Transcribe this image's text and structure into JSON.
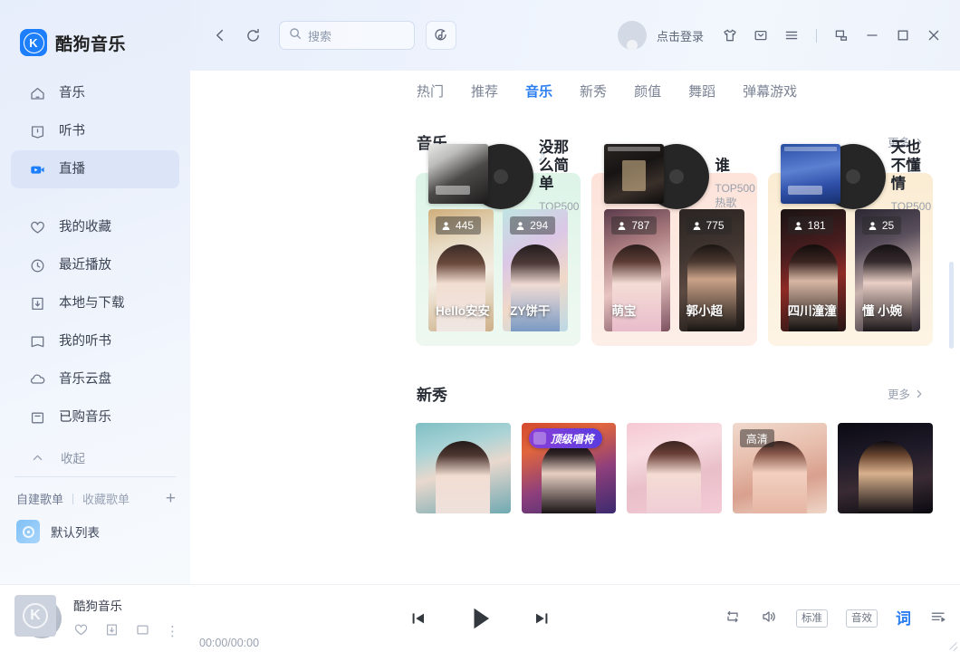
{
  "brand": {
    "name": "酷狗音乐",
    "logo_letter": "K",
    "logo_color": "#1d7ffc"
  },
  "sidebar": {
    "nav_primary": [
      {
        "label": "音乐",
        "icon": "home-icon",
        "active": false
      },
      {
        "label": "听书",
        "icon": "book-icon",
        "active": false
      },
      {
        "label": "直播",
        "icon": "live-icon",
        "active": true
      }
    ],
    "nav_secondary": [
      {
        "label": "我的收藏",
        "icon": "heart-icon"
      },
      {
        "label": "最近播放",
        "icon": "clock-icon"
      },
      {
        "label": "本地与下载",
        "icon": "download-icon"
      },
      {
        "label": "我的听书",
        "icon": "open-book-icon"
      },
      {
        "label": "音乐云盘",
        "icon": "cloud-icon"
      },
      {
        "label": "已购音乐",
        "icon": "purchased-icon"
      }
    ],
    "collapse_label": "收起",
    "playlist_tabs": {
      "own": "自建歌单",
      "favorite": "收藏歌单",
      "add": "+"
    },
    "playlists": [
      {
        "label": "默认列表",
        "icon": "disc-icon"
      }
    ]
  },
  "topbar": {
    "back_icon": "chevron-left-icon",
    "refresh_icon": "refresh-icon",
    "search_placeholder": "搜索",
    "search_value": "",
    "search_icon": "search-icon",
    "recognize_icon": "music-recognition-icon",
    "login_label": "点击登录",
    "icons": [
      "skin-icon",
      "mail-icon",
      "menu-icon"
    ],
    "window_controls": [
      "mini-mode-icon",
      "minimize-icon",
      "maximize-icon",
      "close-icon"
    ]
  },
  "tabs": [
    {
      "label": "热门",
      "active": false
    },
    {
      "label": "推荐",
      "active": false
    },
    {
      "label": "音乐",
      "active": true
    },
    {
      "label": "新秀",
      "active": false
    },
    {
      "label": "颜值",
      "active": false
    },
    {
      "label": "舞蹈",
      "active": false
    },
    {
      "label": "弹幕游戏",
      "active": false
    }
  ],
  "accent_color": "#2b7ef0",
  "sections": [
    {
      "title": "音乐",
      "more_label": "更多",
      "cards": [
        {
          "song_title": "没那么简单",
          "song_sub": "TOP500热歌",
          "bg": "#e4f6ea",
          "lives": [
            {
              "name": "Hello安安",
              "viewers": "445"
            },
            {
              "name": "ZY饼干",
              "viewers": "294"
            }
          ]
        },
        {
          "song_title": "谁",
          "song_sub": "TOP500热歌",
          "bg": "#fde7df",
          "lives": [
            {
              "name": "萌宝",
              "viewers": "787"
            },
            {
              "name": "郭小超",
              "viewers": "775"
            }
          ]
        },
        {
          "song_title": "天也不懂情",
          "song_sub": "TOP500热歌",
          "bg": "#fbefdb",
          "lives": [
            {
              "name": "四川潼潼",
              "viewers": "181"
            },
            {
              "name": "懂 小婉",
              "viewers": "25"
            }
          ]
        }
      ]
    },
    {
      "title": "新秀",
      "more_label": "更多",
      "cells": [
        {
          "badge": "",
          "badge_type": "none"
        },
        {
          "badge": "顶级唱将",
          "badge_type": "crown"
        },
        {
          "badge": "",
          "badge_type": "none"
        },
        {
          "badge": "高清",
          "badge_type": "hd"
        },
        {
          "badge": "",
          "badge_type": "none"
        }
      ]
    }
  ],
  "player": {
    "track_title": "酷狗音乐",
    "time": "00:00/00:00",
    "cover_letter": "K",
    "actions": [
      "heart-icon",
      "download-icon",
      "comment-icon",
      "more-icon"
    ],
    "transport": [
      "previous-icon",
      "play-icon",
      "next-icon"
    ],
    "right": {
      "repeat_icon": "repeat-icon",
      "volume_icon": "volume-icon",
      "quality_label": "标准",
      "effects_label": "音效",
      "lyrics_label": "词",
      "playlist_icon": "playlist-icon"
    }
  }
}
